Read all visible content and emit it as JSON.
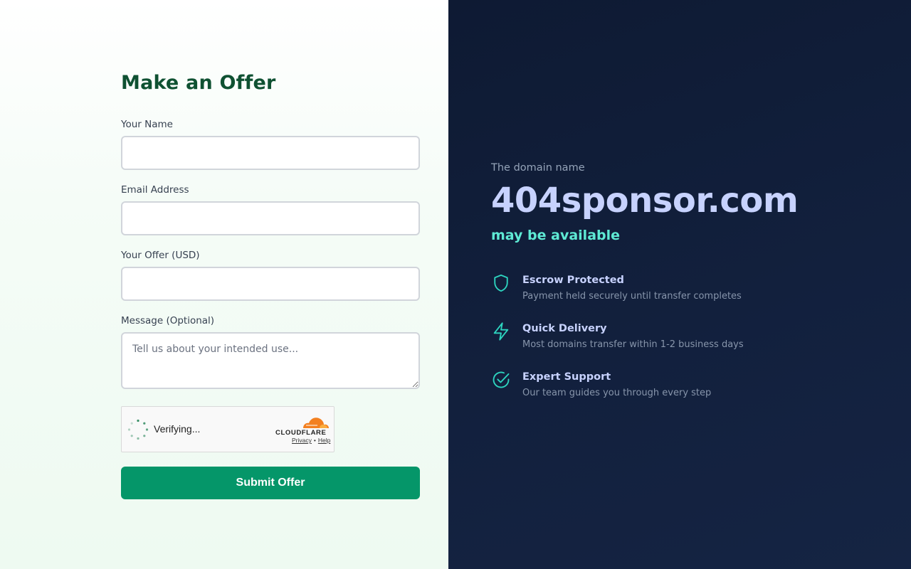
{
  "form": {
    "title": "Make an Offer",
    "fields": {
      "name": {
        "label": "Your Name",
        "value": "",
        "placeholder": ""
      },
      "email": {
        "label": "Email Address",
        "value": "",
        "placeholder": ""
      },
      "offer": {
        "label": "Your Offer (USD)",
        "value": "",
        "placeholder": ""
      },
      "message": {
        "label": "Message (Optional)",
        "value": "",
        "placeholder": "Tell us about your intended use..."
      }
    },
    "captcha": {
      "status": "Verifying...",
      "brand": "CLOUDFLARE",
      "privacy_link": "Privacy",
      "separator": "•",
      "help_link": "Help",
      "brand_color": "#f38020"
    },
    "submit_label": "Submit Offer",
    "submit_color": "#059669",
    "title_color": "#0f5132"
  },
  "domain": {
    "intro": "The domain name",
    "name": "404sponsor.com",
    "status": "may be available",
    "name_color": "#c7d2fe",
    "status_color": "#5eead4"
  },
  "features": [
    {
      "icon": "shield-icon",
      "title": "Escrow Protected",
      "description": "Payment held securely until transfer completes"
    },
    {
      "icon": "lightning-icon",
      "title": "Quick Delivery",
      "description": "Most domains transfer within 1-2 business days"
    },
    {
      "icon": "check-circle-icon",
      "title": "Expert Support",
      "description": "Our team guides you through every step"
    }
  ],
  "theme": {
    "accent": "#2dd4bf",
    "panel_background": "#0e1a33"
  }
}
